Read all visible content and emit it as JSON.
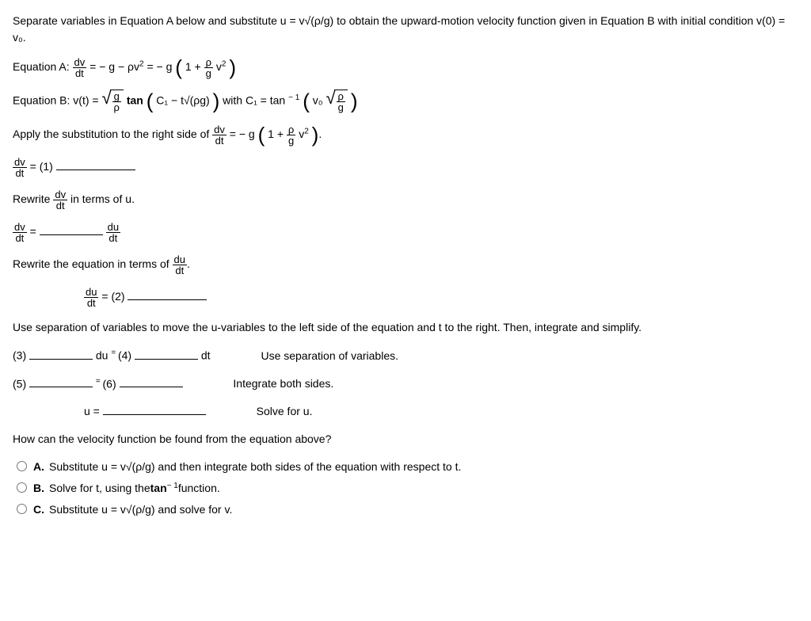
{
  "intro": "Separate variables in Equation A below and substitute u = v√(ρ/g) to obtain the upward-motion velocity function given in Equation B with initial condition v(0) = v₀.",
  "eqA_label": "Equation A:",
  "eqA_lhs_num": "dv",
  "eqA_lhs_den": "dt",
  "eqA_mid": " = − g − ρv",
  "eqA_exp": "2",
  "eqA_eq2": " = − g",
  "eqA_paren_inner1": "1 + ",
  "eqA_frac_num": "ρ",
  "eqA_frac_den": "g",
  "eqA_v2": "v",
  "eqA_v2exp": "2",
  "eqB_label": "Equation B: v(t) = ",
  "eqB_sqrt_num": "g",
  "eqB_sqrt_den": "ρ",
  "eqB_tan": " tan ",
  "eqB_inside": "C₁ − t√(ρg)",
  "eqB_with": " with C₁ = tan",
  "eqB_minus1": "− 1",
  "eqB_arg_v0": "v₀",
  "eqB_arg_num": "ρ",
  "eqB_arg_den": "g",
  "apply_text": "Apply the substitution to the right side of ",
  "apply_num": "dv",
  "apply_den": "dt",
  "apply_eq": " = − g",
  "apply_inner1": "1 + ",
  "apply_frac_num": "ρ",
  "apply_frac_den": "g",
  "apply_v2": "v",
  "apply_v2exp": "2",
  "step1_num": "dv",
  "step1_den": "dt",
  "step1_eq": " = (1) ",
  "rewrite_dvdt": "Rewrite ",
  "rewrite_frac_num": "dv",
  "rewrite_frac_den": "dt",
  "rewrite_tail": " in terms of u.",
  "step2_lhs_num": "dv",
  "step2_lhs_den": "dt",
  "step2_eq_sym": " = ",
  "step2_rhs_num": "du",
  "step2_rhs_den": "dt",
  "rewrite_eq_text": "Rewrite the equation in terms of ",
  "rewrite_eq_num": "du",
  "rewrite_eq_den": "dt",
  "step3_lhs_num": "du",
  "step3_lhs_den": "dt",
  "step3_rhs": "(2) ",
  "sep_text": "Use separation of variables to move the u-variables to the left side of the equation and t to the right. Then, integrate and simplify.",
  "line4_a": "(3) ",
  "line4_du": " du",
  "line4_eq": " = ",
  "line4_b": "(4) ",
  "line4_dt": " dt",
  "note_sep": "Use separation of variables.",
  "line5_a": "(5) ",
  "line5_eq": " = ",
  "line5_b": "(6) ",
  "note_int": "Integrate both sides.",
  "line6_u": "u = ",
  "note_solve": "Solve for u.",
  "how_text": "How can the velocity function be found from the equation above?",
  "mc_A": "Substitute u = v√(ρ/g) and then integrate both sides of the equation with respect to t.",
  "mc_B_a": "Solve for t, using the ",
  "mc_B_tan": "tan",
  "mc_B_exp": "− 1",
  "mc_B_b": " function.",
  "mc_C": "Substitute u = v√(ρ/g) and solve for v."
}
